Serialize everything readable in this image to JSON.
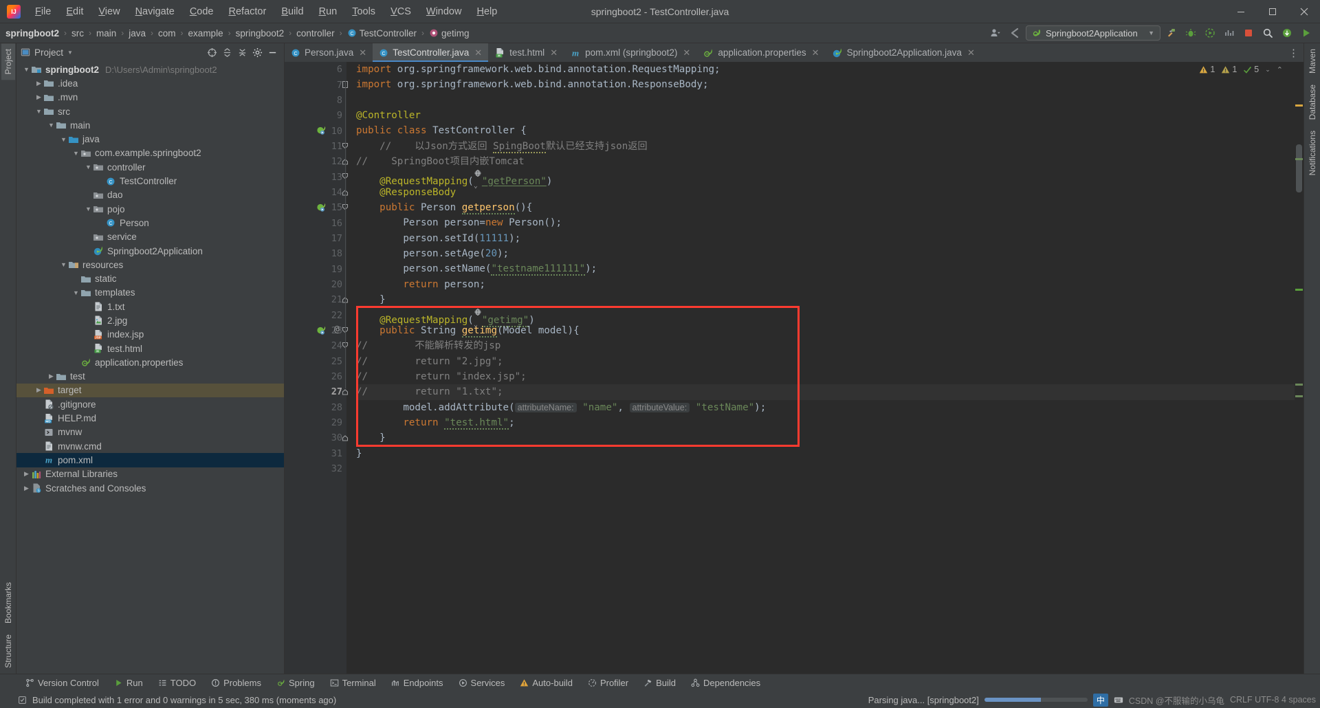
{
  "window": {
    "title": "springboot2 - TestController.java",
    "controls": {
      "minimize": "—",
      "maximize": "▢",
      "close": "✕"
    }
  },
  "menubar": [
    {
      "label": "File"
    },
    {
      "label": "Edit"
    },
    {
      "label": "View"
    },
    {
      "label": "Navigate"
    },
    {
      "label": "Code"
    },
    {
      "label": "Refactor"
    },
    {
      "label": "Build"
    },
    {
      "label": "Run"
    },
    {
      "label": "Tools"
    },
    {
      "label": "VCS"
    },
    {
      "label": "Window"
    },
    {
      "label": "Help"
    }
  ],
  "navbar": {
    "crumbs": [
      {
        "label": "springboot2",
        "bold": true,
        "icon": "none"
      },
      {
        "label": "src",
        "icon": "none"
      },
      {
        "label": "main",
        "icon": "none"
      },
      {
        "label": "java",
        "icon": "none"
      },
      {
        "label": "com",
        "icon": "none"
      },
      {
        "label": "example",
        "icon": "none"
      },
      {
        "label": "springboot2",
        "icon": "none"
      },
      {
        "label": "controller",
        "icon": "none"
      },
      {
        "label": "TestController",
        "icon": "class-icon"
      },
      {
        "label": "getimg",
        "icon": "method-icon"
      }
    ],
    "separator": "›",
    "run_configuration": "Springboot2Application",
    "toolbar_icons": [
      "user-icon",
      "back-icon",
      "run-config-dropdown",
      "build-icon",
      "debug-icon",
      "run-with-coverage-icon",
      "profiler-icon",
      "stop-icon",
      "search-icon",
      "update-icon",
      "run-icon"
    ]
  },
  "left_strip": {
    "tabs": [
      "Project",
      "Bookmarks",
      "Structure"
    ],
    "active": "Project"
  },
  "right_strip": {
    "tabs": [
      "Maven",
      "Database",
      "Notifications"
    ]
  },
  "project_panel": {
    "title": "Project",
    "header_icons": [
      "scope-icon",
      "collapse-all-icon",
      "expand-icon",
      "settings-gear-icon",
      "hide-icon"
    ],
    "tree": [
      {
        "depth": 0,
        "arrow": "down",
        "icon": "module-folder-icon",
        "label": "springboot2",
        "bold": true,
        "path": "D:\\Users\\Admin\\springboot2"
      },
      {
        "depth": 1,
        "arrow": "right",
        "icon": "folder-icon",
        "label": ".idea"
      },
      {
        "depth": 1,
        "arrow": "right",
        "icon": "folder-icon",
        "label": ".mvn"
      },
      {
        "depth": 1,
        "arrow": "down",
        "icon": "folder-icon",
        "label": "src"
      },
      {
        "depth": 2,
        "arrow": "down",
        "icon": "folder-icon",
        "label": "main"
      },
      {
        "depth": 3,
        "arrow": "down",
        "icon": "source-folder-icon",
        "label": "java"
      },
      {
        "depth": 4,
        "arrow": "down",
        "icon": "package-icon",
        "label": "com.example.springboot2"
      },
      {
        "depth": 5,
        "arrow": "down",
        "icon": "package-icon",
        "label": "controller"
      },
      {
        "depth": 6,
        "arrow": "none",
        "icon": "class-icon",
        "label": "TestController"
      },
      {
        "depth": 5,
        "arrow": "none",
        "icon": "package-icon",
        "label": "dao"
      },
      {
        "depth": 5,
        "arrow": "down",
        "icon": "package-icon",
        "label": "pojo"
      },
      {
        "depth": 6,
        "arrow": "none",
        "icon": "class-icon",
        "label": "Person"
      },
      {
        "depth": 5,
        "arrow": "none",
        "icon": "package-icon",
        "label": "service"
      },
      {
        "depth": 5,
        "arrow": "none",
        "icon": "spring-boot-icon",
        "label": "Springboot2Application"
      },
      {
        "depth": 3,
        "arrow": "down",
        "icon": "resource-folder-icon",
        "label": "resources"
      },
      {
        "depth": 4,
        "arrow": "none",
        "icon": "folder-icon",
        "label": "static"
      },
      {
        "depth": 4,
        "arrow": "down",
        "icon": "folder-icon",
        "label": "templates"
      },
      {
        "depth": 5,
        "arrow": "none",
        "icon": "text-file-icon",
        "label": "1.txt"
      },
      {
        "depth": 5,
        "arrow": "none",
        "icon": "image-file-icon",
        "label": "2.jpg"
      },
      {
        "depth": 5,
        "arrow": "none",
        "icon": "jsp-file-icon",
        "label": "index.jsp"
      },
      {
        "depth": 5,
        "arrow": "none",
        "icon": "html-file-icon",
        "label": "test.html"
      },
      {
        "depth": 4,
        "arrow": "none",
        "icon": "spring-properties-icon",
        "label": "application.properties"
      },
      {
        "depth": 2,
        "arrow": "right",
        "icon": "folder-icon",
        "label": "test"
      },
      {
        "depth": 1,
        "arrow": "right",
        "icon": "target-folder-icon",
        "label": "target",
        "selected": "brown"
      },
      {
        "depth": 1,
        "arrow": "none",
        "icon": "gitignore-icon",
        "label": ".gitignore"
      },
      {
        "depth": 1,
        "arrow": "none",
        "icon": "markdown-file-icon",
        "label": "HELP.md"
      },
      {
        "depth": 1,
        "arrow": "none",
        "icon": "script-file-icon",
        "label": "mvnw"
      },
      {
        "depth": 1,
        "arrow": "none",
        "icon": "text-file-icon",
        "label": "mvnw.cmd"
      },
      {
        "depth": 1,
        "arrow": "none",
        "icon": "maven-file-icon",
        "label": "pom.xml",
        "selected": "blue"
      },
      {
        "depth": 0,
        "arrow": "right",
        "icon": "libraries-icon",
        "label": "External Libraries"
      },
      {
        "depth": 0,
        "arrow": "right",
        "icon": "scratches-icon",
        "label": "Scratches and Consoles"
      }
    ]
  },
  "editor": {
    "tabs": [
      {
        "label": "Person.java",
        "icon": "class-icon",
        "active": false
      },
      {
        "label": "TestController.java",
        "icon": "class-icon",
        "active": true
      },
      {
        "label": "test.html",
        "icon": "html-file-icon",
        "active": false
      },
      {
        "label": "pom.xml (springboot2)",
        "icon": "maven-file-icon",
        "active": false
      },
      {
        "label": "application.properties",
        "icon": "spring-properties-icon",
        "active": false
      },
      {
        "label": "Springboot2Application.java",
        "icon": "spring-boot-icon",
        "active": false
      }
    ],
    "inspection": {
      "warnings": "1",
      "weak_warnings": "1",
      "typos": "5"
    },
    "first_line_number": 6,
    "current_line": 27,
    "lines": [
      {
        "n": 6,
        "gutter": "",
        "fold": "",
        "html": "<span class=\"kw\">import</span> <span class=\"typ\">org.springframework.web.bind.annotation.RequestMapping</span><span class=\"typ\">;</span>"
      },
      {
        "n": 7,
        "gutter": "",
        "fold": "foldA",
        "html": "<span class=\"kw\">import</span> <span class=\"typ\">org.springframework.web.bind.annotation.ResponseBody</span><span class=\"typ\">;</span>"
      },
      {
        "n": 8,
        "gutter": "",
        "fold": "",
        "html": ""
      },
      {
        "n": 9,
        "gutter": "",
        "fold": "",
        "html": "<span class=\"ann\">@Controller</span>"
      },
      {
        "n": 10,
        "gutter": "spring-bean-icon",
        "fold": "",
        "html": "<span class=\"kw\">public</span> <span class=\"kw\">class</span> <span class=\"typ\">TestController</span> {"
      },
      {
        "n": 11,
        "gutter": "",
        "fold": "foldT",
        "html": "    <span class=\"cmt\">//    以Json方式返回 <span class=\"sqg\">SpingBoot</span>默认已经支持json返回</span>"
      },
      {
        "n": 12,
        "gutter": "",
        "fold": "foldB",
        "html": "<span class=\"cmt\">//    SpringBoot项目内嵌Tomcat</span>"
      },
      {
        "n": 13,
        "gutter": "",
        "fold": "foldT",
        "html": "    <span class=\"ann\">@RequestMapping</span>(<span class=\"webicon\"></span><span class=\"str und\">\"getPerson\"</span>)"
      },
      {
        "n": 14,
        "gutter": "",
        "fold": "foldB",
        "html": "    <span class=\"ann\">@ResponseBody</span>"
      },
      {
        "n": 15,
        "gutter": "spring-mapping-icon",
        "fold": "foldT",
        "html": "    <span class=\"kw\">public</span> <span class=\"typ\">Person</span> <span class=\"mth sq\">getperson</span>(){"
      },
      {
        "n": 16,
        "gutter": "",
        "fold": "",
        "html": "        <span class=\"typ\">Person</span> person=<span class=\"kw\">new</span> <span class=\"typ\">Person</span>();"
      },
      {
        "n": 17,
        "gutter": "",
        "fold": "",
        "html": "        person.setId(<span class=\"num\">11111</span>);"
      },
      {
        "n": 18,
        "gutter": "",
        "fold": "",
        "html": "        person.setAge(<span class=\"num\">20</span>);"
      },
      {
        "n": 19,
        "gutter": "",
        "fold": "",
        "html": "        person.setName(<span class=\"str sq\">\"testname111111\"</span>);"
      },
      {
        "n": 20,
        "gutter": "",
        "fold": "",
        "html": "        <span class=\"kw\">return</span> person;"
      },
      {
        "n": 21,
        "gutter": "",
        "fold": "foldB",
        "html": "    }"
      },
      {
        "n": 22,
        "gutter": "",
        "fold": "",
        "html": "    <span class=\"ann\">@RequestMapping</span>(<span class=\"webicon\"></span><span class=\"str sq\">\"getimg\"</span>)"
      },
      {
        "n": 23,
        "gutter": "spring-mapping-icon",
        "fold": "foldT",
        "at": "@",
        "html": "    <span class=\"kw\">public</span> <span class=\"typ\">String</span> <span class=\"mth sq\">getimg</span>(<span class=\"typ\">Model</span> model){"
      },
      {
        "n": 24,
        "gutter": "",
        "fold": "foldT",
        "html": "<span class=\"cmt\">//        不能解析转发的jsp</span>"
      },
      {
        "n": 25,
        "gutter": "",
        "fold": "",
        "html": "<span class=\"cmt\">//        return \"2.jpg\";</span>"
      },
      {
        "n": 26,
        "gutter": "",
        "fold": "",
        "html": "<span class=\"cmt\">//        return \"index.jsp\";</span>"
      },
      {
        "n": 27,
        "gutter": "",
        "fold": "foldB",
        "current": true,
        "html": "<span class=\"cmt\">//        return \"1.txt\";</span>"
      },
      {
        "n": 28,
        "gutter": "",
        "fold": "",
        "html": "        model.addAttribute(<span class=\"hintchip\">attributeName:</span> <span class=\"str\">\"name\"</span>, <span class=\"hintchip\">attributeValue:</span> <span class=\"str\">\"testName\"</span>);"
      },
      {
        "n": 29,
        "gutter": "",
        "fold": "",
        "html": "        <span class=\"kw\">return</span> <span class=\"str sq\">\"test.html\"</span>;"
      },
      {
        "n": 30,
        "gutter": "",
        "fold": "foldB",
        "html": "    }"
      },
      {
        "n": 31,
        "gutter": "",
        "fold": "",
        "html": "}"
      },
      {
        "n": 32,
        "gutter": "",
        "fold": "",
        "html": ""
      }
    ],
    "highlight_box": {
      "label": "red-highlight-rectangle"
    }
  },
  "bottom_tool_windows": [
    {
      "label": "Version Control",
      "icon": "branch-icon"
    },
    {
      "label": "Run",
      "icon": "run-icon"
    },
    {
      "label": "TODO",
      "icon": "todo-icon"
    },
    {
      "label": "Problems",
      "icon": "problems-icon"
    },
    {
      "label": "Spring",
      "icon": "spring-icon"
    },
    {
      "label": "Terminal",
      "icon": "terminal-icon"
    },
    {
      "label": "Endpoints",
      "icon": "endpoints-icon"
    },
    {
      "label": "Services",
      "icon": "services-icon"
    },
    {
      "label": "Auto-build",
      "icon": "warning-icon"
    },
    {
      "label": "Profiler",
      "icon": "profiler-icon"
    },
    {
      "label": "Build",
      "icon": "build-icon"
    },
    {
      "label": "Dependencies",
      "icon": "dependencies-icon"
    }
  ],
  "statusbar": {
    "build_message": "Build completed with 1 error and 0 warnings in 5 sec, 380 ms (moments ago)",
    "background_task": "Parsing java... [springboot2]",
    "progress_percent": 55,
    "ime_indicator": "中",
    "ime_label": "中",
    "watermark": "CSDN @不服输的小乌龟",
    "encoding_hint": "CRLF  UTF-8  4 spaces"
  },
  "colors": {
    "accent_blue": "#4a88c7",
    "editor_bg": "#2b2b2b",
    "panel_bg": "#3c3f41",
    "gutter_bg": "#313335",
    "selection_blue": "#0d293e",
    "selection_brown": "#57513b",
    "highlight_red": "#ff3b30",
    "keyword": "#cc7832",
    "string": "#6a8759",
    "annotation": "#bbb529",
    "number": "#6897bb",
    "comment": "#808080"
  }
}
